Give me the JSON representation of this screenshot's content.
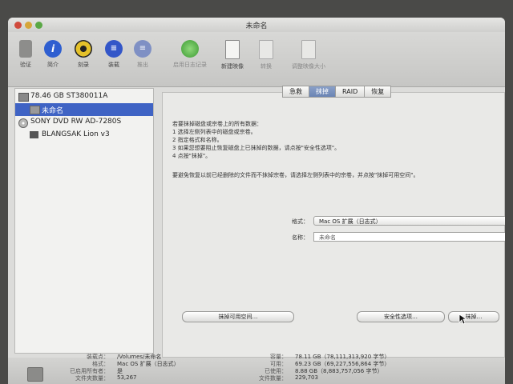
{
  "window": {
    "title": "未命名"
  },
  "toolbar": {
    "items": [
      {
        "label": "验证",
        "icon": "microscope-icon"
      },
      {
        "label": "简介",
        "icon": "info-icon"
      },
      {
        "label": "刻录",
        "icon": "burn-icon"
      },
      {
        "label": "装载",
        "icon": "mount-icon"
      },
      {
        "label": "推出",
        "icon": "eject-icon"
      },
      {
        "label": "启用日志记录",
        "icon": "journal-icon"
      },
      {
        "label": "新建映像",
        "icon": "new-image-icon"
      },
      {
        "label": "转换",
        "icon": "convert-icon"
      },
      {
        "label": "调整映像大小",
        "icon": "resize-image-icon"
      }
    ]
  },
  "sidebar": {
    "items": [
      {
        "label": "78.46 GB ST380011A",
        "icon": "hard-disk-icon"
      },
      {
        "label": "未命名",
        "icon": "volume-icon"
      },
      {
        "label": "SONY DVD RW AD-7280S",
        "icon": "optical-drive-icon"
      },
      {
        "label": "BLANGSAK Lion v3",
        "icon": "disc-image-icon"
      }
    ]
  },
  "tabs": [
    "急救",
    "抹掉",
    "RAID",
    "恢复"
  ],
  "instructions": {
    "lines": [
      "若要抹掉磁盘或宗卷上的所有数据：",
      "1  选择左侧列表中的磁盘或宗卷。",
      "2  指定格式和名称。",
      "3  如果您想要阻止恢复磁盘上已抹掉的数据，请点按\"安全性选项\"。",
      "4  点按\"抹掉\"。"
    ],
    "note": "要避免恢复以前已经删除的文件而不抹掉宗卷，请选择左侧列表中的宗卷，并点按\"抹掉可用空间\"。"
  },
  "form": {
    "format_label": "格式：",
    "format_value": "Mac OS 扩展（日志式）",
    "name_label": "名称：",
    "name_value": "未命名"
  },
  "buttons": {
    "erase_free_space": "抹掉可用空间…",
    "security_options": "安全性选项…",
    "erase": "抹掉…"
  },
  "info": {
    "left": [
      {
        "label": "装载点：",
        "value": "/Volumes/未命名"
      },
      {
        "label": "格式：",
        "value": "Mac OS 扩展（日志式）"
      },
      {
        "label": "已启用所有者：",
        "value": "是"
      },
      {
        "label": "文件夹数量：",
        "value": "53,267"
      }
    ],
    "right": [
      {
        "label": "容量：",
        "value": "78.11 GB（78,111,313,920 字节）"
      },
      {
        "label": "可用：",
        "value": "69.23 GB（69,227,556,864 字节）"
      },
      {
        "label": "已使用：",
        "value": "8.88 GB（8,883,757,056 字节）"
      },
      {
        "label": "文件数量：",
        "value": "229,703"
      }
    ]
  },
  "colors": {
    "selection": "#3f63c4",
    "active_tab": "#6a84b4"
  }
}
